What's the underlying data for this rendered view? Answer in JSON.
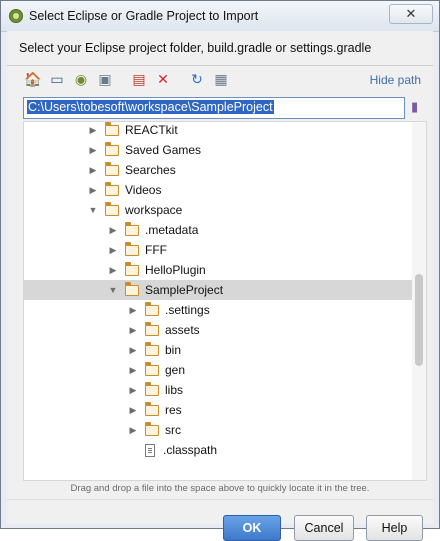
{
  "window": {
    "title": "Select Eclipse or Gradle Project to Import",
    "close_glyph": "✕"
  },
  "instruction": "Select your Eclipse project folder, build.gradle or settings.gradle",
  "toolbar": {
    "items": [
      {
        "name": "home-icon",
        "glyph": "🏠",
        "color": "#c0392b"
      },
      {
        "name": "desktop-icon",
        "glyph": "▭",
        "color": "#2e5c8a"
      },
      {
        "name": "project-icon",
        "glyph": "◉",
        "color": "#6f8f2f"
      },
      {
        "name": "module-icon",
        "glyph": "▣",
        "color": "#6b7b8c"
      },
      {
        "name": "new-folder-icon",
        "glyph": "▤",
        "color": "#c0392b"
      },
      {
        "name": "delete-icon",
        "glyph": "✕",
        "color": "#d9262e"
      },
      {
        "name": "refresh-icon",
        "glyph": "↻",
        "color": "#2e6fbf"
      },
      {
        "name": "show-hidden-icon",
        "glyph": "▦",
        "color": "#6b7b8c"
      }
    ],
    "hide_path": "Hide path"
  },
  "path": {
    "value": "C:\\Users\\tobesoft\\workspace\\SampleProject"
  },
  "tree": {
    "rows": [
      {
        "label": "REACTkit",
        "indent": 3,
        "expanded": false,
        "type": "folder"
      },
      {
        "label": "Saved Games",
        "indent": 3,
        "expanded": false,
        "type": "folder"
      },
      {
        "label": "Searches",
        "indent": 3,
        "expanded": false,
        "type": "folder"
      },
      {
        "label": "Videos",
        "indent": 3,
        "expanded": false,
        "type": "folder"
      },
      {
        "label": "workspace",
        "indent": 3,
        "expanded": true,
        "type": "folder"
      },
      {
        "label": ".metadata",
        "indent": 4,
        "expanded": false,
        "type": "folder"
      },
      {
        "label": "FFF",
        "indent": 4,
        "expanded": false,
        "type": "folder"
      },
      {
        "label": "HelloPlugin",
        "indent": 4,
        "expanded": false,
        "type": "folder"
      },
      {
        "label": "SampleProject",
        "indent": 4,
        "expanded": true,
        "type": "folder",
        "selected": true
      },
      {
        "label": ".settings",
        "indent": 5,
        "expanded": false,
        "type": "folder"
      },
      {
        "label": "assets",
        "indent": 5,
        "expanded": false,
        "type": "folder"
      },
      {
        "label": "bin",
        "indent": 5,
        "expanded": false,
        "type": "folder"
      },
      {
        "label": "gen",
        "indent": 5,
        "expanded": false,
        "type": "folder"
      },
      {
        "label": "libs",
        "indent": 5,
        "expanded": false,
        "type": "folder"
      },
      {
        "label": "res",
        "indent": 5,
        "expanded": false,
        "type": "folder"
      },
      {
        "label": "src",
        "indent": 5,
        "expanded": false,
        "type": "folder"
      },
      {
        "label": ".classpath",
        "indent": 5,
        "expanded": false,
        "type": "file"
      }
    ]
  },
  "hint": "Drag and drop a file into the space above to quickly locate it in the tree.",
  "buttons": {
    "ok": "OK",
    "cancel": "Cancel",
    "help": "Help"
  }
}
